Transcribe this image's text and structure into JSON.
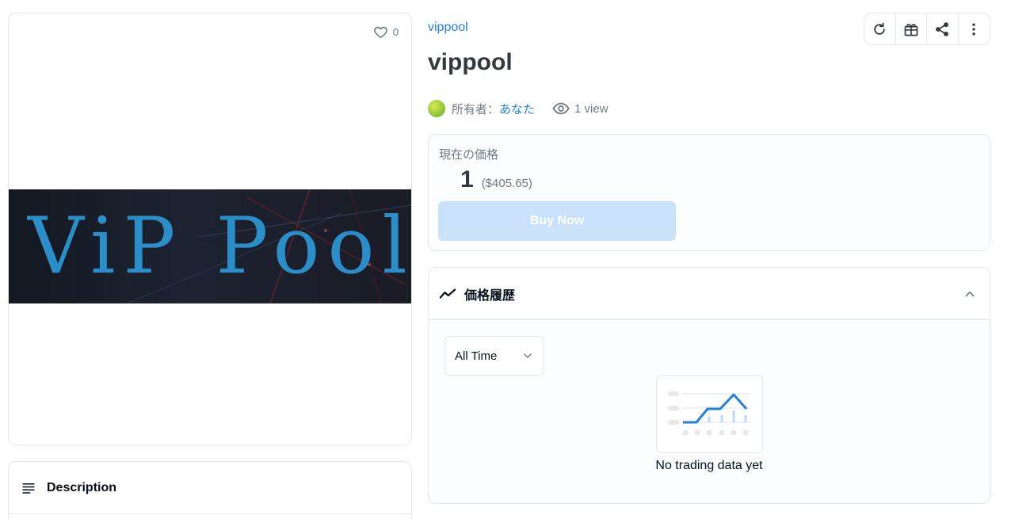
{
  "item": {
    "collection": "vippool",
    "title": "vippool",
    "favorites": "0",
    "banner_text": "ViP Pool"
  },
  "owner": {
    "prefix": "所有者：",
    "name": "あなた",
    "views": "1 view"
  },
  "price": {
    "label": "現在の価格",
    "value": "1",
    "usd": "($405.65)",
    "buy_label": "Buy Now"
  },
  "history": {
    "title": "価格履歴",
    "period": "All Time",
    "empty_text": "No trading data yet"
  },
  "description": {
    "title": "Description"
  },
  "toolbar": {
    "icons": [
      "refresh-icon",
      "gift-icon",
      "share-icon",
      "more-vertical-icon"
    ]
  },
  "colors": {
    "link": "#2081e2",
    "buy_disabled": "#c9e2fa",
    "banner_text": "#2a8fc9",
    "chart_line": "#2081e2"
  }
}
